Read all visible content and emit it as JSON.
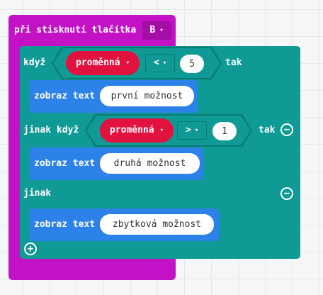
{
  "event_block": {
    "label": "při stisknutí tlačítka",
    "button_value": "B"
  },
  "if_block": {
    "if_label": "když",
    "then_label": "tak",
    "condition": {
      "variable": "proměnná",
      "operator": "<",
      "value": "5"
    },
    "statement": {
      "label": "zobraz text",
      "text": "první možnost"
    },
    "else_if_label": "jinak když",
    "else_if_then_label": "tak",
    "else_if_condition": {
      "variable": "proměnná",
      "operator": ">",
      "value": "1"
    },
    "else_if_statement": {
      "label": "zobraz text",
      "text": "druhá možnost"
    },
    "else_label": "jinak",
    "else_statement": {
      "label": "zobraz text",
      "text": "zbytková možnost"
    }
  },
  "icons": {
    "caret": "▾",
    "remove": "−",
    "add": "+"
  },
  "colors": {
    "event": "#c312c6",
    "control": "#0f9a95",
    "statement": "#2c82e8",
    "variable": "#e2123f"
  }
}
